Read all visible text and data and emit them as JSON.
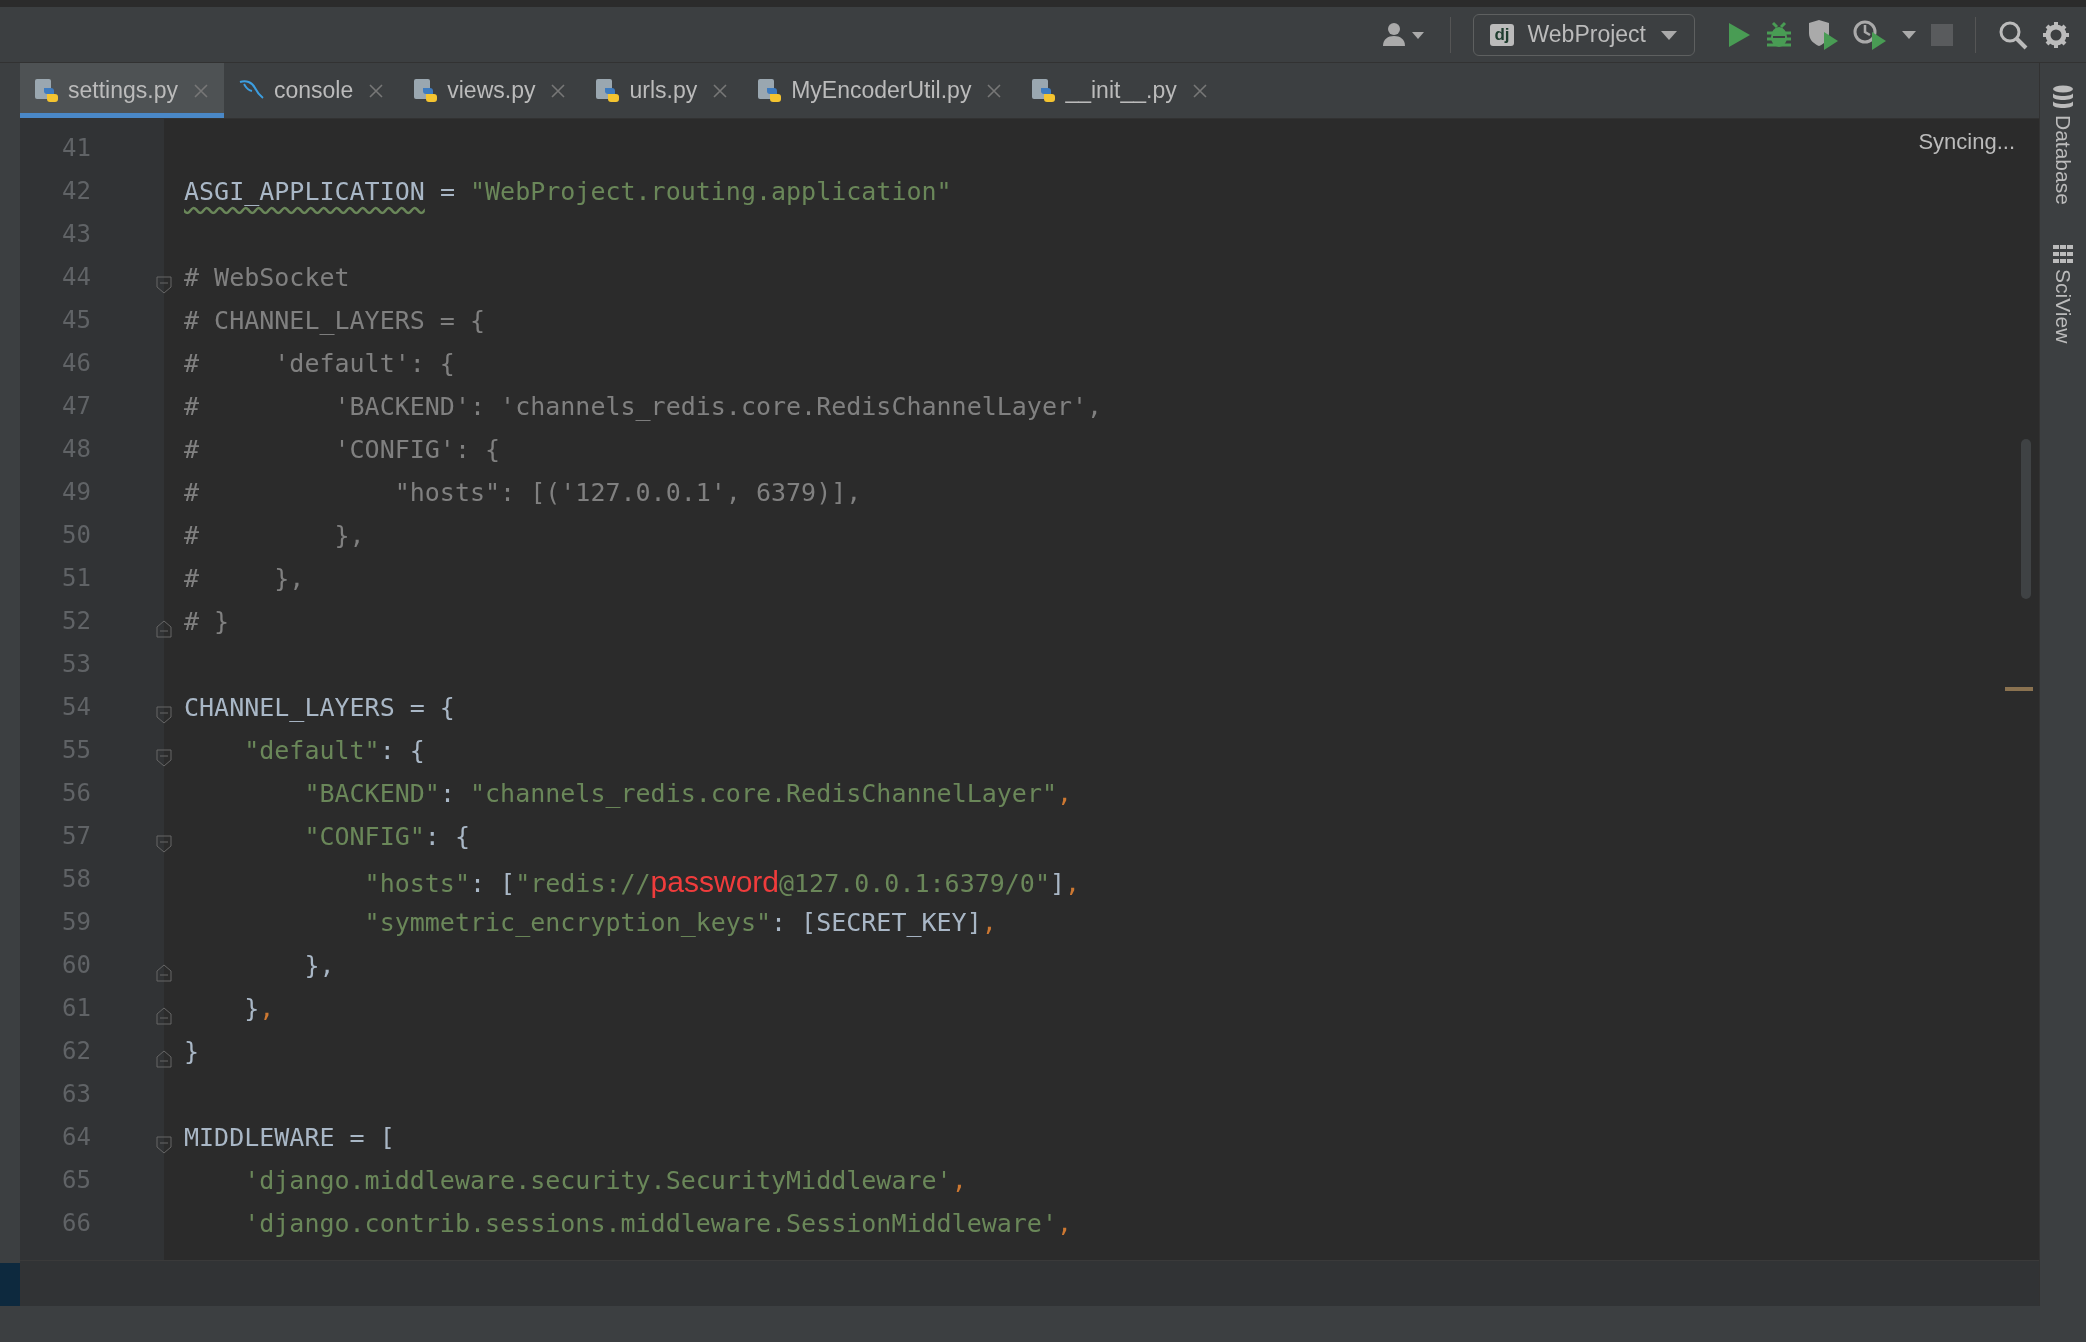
{
  "toolbar": {
    "config": {
      "badge": "dj",
      "label": "WebProject"
    }
  },
  "tabs": [
    {
      "label": "settings.py",
      "kind": "python",
      "selected": true
    },
    {
      "label": "console",
      "kind": "database",
      "selected": false
    },
    {
      "label": "views.py",
      "kind": "python",
      "selected": false
    },
    {
      "label": "urls.py",
      "kind": "python",
      "selected": false
    },
    {
      "label": "MyEncoderUtil.py",
      "kind": "python",
      "selected": false
    },
    {
      "label": "__init__.py",
      "kind": "python",
      "selected": false
    }
  ],
  "editor": {
    "status": "Syncing...",
    "lines": [
      {
        "number": "41",
        "fold_start": false,
        "fold_end": false
      },
      {
        "number": "42",
        "fold_start": false,
        "fold_end": false,
        "tokens": [
          {
            "text": "ASGI_APPLICATION",
            "kind": "typo"
          },
          {
            "text": " = ",
            "kind": "plain"
          },
          {
            "text": "\"WebProject.routing.application\"",
            "kind": "string"
          }
        ]
      },
      {
        "number": "43",
        "fold_start": false,
        "fold_end": false
      },
      {
        "number": "44",
        "fold_start": true,
        "fold_end": false,
        "tokens": [
          {
            "text": "# WebSocket",
            "kind": "comment"
          }
        ]
      },
      {
        "number": "45",
        "fold_start": false,
        "fold_end": false,
        "tokens": [
          {
            "text": "# CHANNEL_LAYERS = {",
            "kind": "comment"
          }
        ]
      },
      {
        "number": "46",
        "fold_start": false,
        "fold_end": false,
        "tokens": [
          {
            "text": "#     'default': {",
            "kind": "comment"
          }
        ]
      },
      {
        "number": "47",
        "fold_start": false,
        "fold_end": false,
        "tokens": [
          {
            "text": "#         'BACKEND': 'channels_redis.core.RedisChannelLayer',",
            "kind": "comment"
          }
        ]
      },
      {
        "number": "48",
        "fold_start": false,
        "fold_end": false,
        "tokens": [
          {
            "text": "#         'CONFIG': {",
            "kind": "comment"
          }
        ]
      },
      {
        "number": "49",
        "fold_start": false,
        "fold_end": false,
        "tokens": [
          {
            "text": "#             \"hosts\": [('127.0.0.1', 6379)],",
            "kind": "comment"
          }
        ]
      },
      {
        "number": "50",
        "fold_start": false,
        "fold_end": false,
        "tokens": [
          {
            "text": "#         },",
            "kind": "comment"
          }
        ]
      },
      {
        "number": "51",
        "fold_start": false,
        "fold_end": false,
        "tokens": [
          {
            "text": "#     },",
            "kind": "comment"
          }
        ]
      },
      {
        "number": "52",
        "fold_start": false,
        "fold_end": true,
        "tokens": [
          {
            "text": "# }",
            "kind": "comment"
          }
        ]
      },
      {
        "number": "53",
        "fold_start": false,
        "fold_end": false
      },
      {
        "number": "54",
        "fold_start": true,
        "fold_end": false,
        "tokens": [
          {
            "text": "CHANNEL_LAYERS = {",
            "kind": "plain"
          }
        ]
      },
      {
        "number": "55",
        "fold_start": true,
        "fold_end": false,
        "tokens": [
          {
            "text": "    \"default\"",
            "kind": "string"
          },
          {
            "text": ": {",
            "kind": "plain"
          }
        ]
      },
      {
        "number": "56",
        "fold_start": false,
        "fold_end": false,
        "tokens": [
          {
            "text": "        \"BACKEND\"",
            "kind": "string"
          },
          {
            "text": ": ",
            "kind": "plain"
          },
          {
            "text": "\"channels_redis.core.RedisChannelLayer\"",
            "kind": "string"
          },
          {
            "text": ",",
            "kind": "keyword"
          }
        ]
      },
      {
        "number": "57",
        "fold_start": true,
        "fold_end": false,
        "tokens": [
          {
            "text": "        \"CONFIG\"",
            "kind": "string"
          },
          {
            "text": ": {",
            "kind": "plain"
          }
        ]
      },
      {
        "number": "58",
        "fold_start": false,
        "fold_end": false,
        "tokens": [
          {
            "text": "            \"hosts\"",
            "kind": "string"
          },
          {
            "text": ": [",
            "kind": "plain"
          },
          {
            "text": "\"redis://",
            "kind": "string"
          },
          {
            "text": "password",
            "kind": "redaction"
          },
          {
            "text": "@127.0.0.1:6379/0\"",
            "kind": "string"
          },
          {
            "text": "]",
            "kind": "plain"
          },
          {
            "text": ",",
            "kind": "keyword"
          }
        ]
      },
      {
        "number": "59",
        "fold_start": false,
        "fold_end": false,
        "tokens": [
          {
            "text": "            \"symmetric_encryption_keys\"",
            "kind": "string"
          },
          {
            "text": ": [SECRET_KEY]",
            "kind": "plain"
          },
          {
            "text": ",",
            "kind": "keyword"
          }
        ]
      },
      {
        "number": "60",
        "fold_start": false,
        "fold_end": true,
        "tokens": [
          {
            "text": "        },",
            "kind": "plain"
          }
        ]
      },
      {
        "number": "61",
        "fold_start": false,
        "fold_end": true,
        "tokens": [
          {
            "text": "    }",
            "kind": "plain"
          },
          {
            "text": ",",
            "kind": "keyword"
          }
        ]
      },
      {
        "number": "62",
        "fold_start": false,
        "fold_end": true,
        "tokens": [
          {
            "text": "}",
            "kind": "plain"
          }
        ]
      },
      {
        "number": "63",
        "fold_start": false,
        "fold_end": false
      },
      {
        "number": "64",
        "fold_start": true,
        "fold_end": false,
        "tokens": [
          {
            "text": "MIDDLEWARE = [",
            "kind": "plain"
          }
        ]
      },
      {
        "number": "65",
        "fold_start": false,
        "fold_end": false,
        "tokens": [
          {
            "text": "    'django.middleware.security.SecurityMiddleware'",
            "kind": "string"
          },
          {
            "text": ",",
            "kind": "keyword"
          }
        ]
      },
      {
        "number": "66",
        "fold_start": false,
        "fold_end": false,
        "tokens": [
          {
            "text": "    'django.contrib.sessions.middleware.SessionMiddleware'",
            "kind": "string"
          },
          {
            "text": ",",
            "kind": "keyword"
          }
        ]
      }
    ]
  },
  "tool_windows": [
    {
      "label": "Database",
      "kind": "database"
    },
    {
      "label": "SciView",
      "kind": "grid"
    }
  ]
}
